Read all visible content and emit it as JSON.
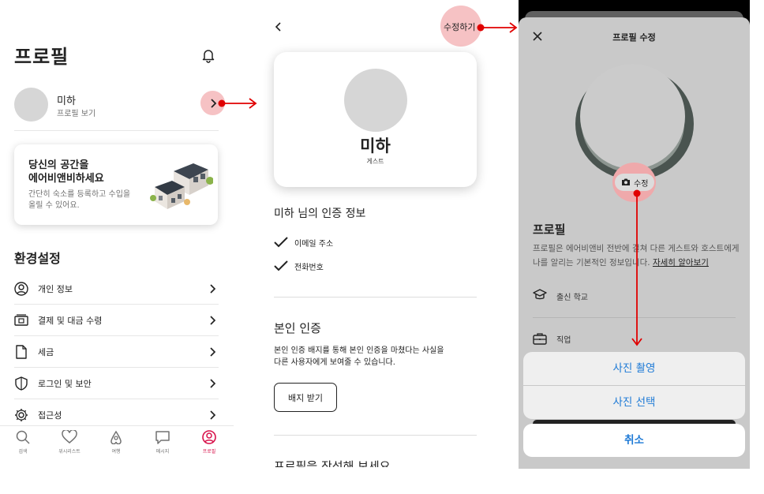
{
  "screen1": {
    "title": "프로필",
    "user": {
      "name": "미하",
      "sub": "프로필 보기"
    },
    "host_card": {
      "title": "당신의 공간을\n에어비앤비하세요",
      "desc": "간단히 숙소를 등록하고 수입을\n올릴 수 있어요."
    },
    "settings_title": "환경설정",
    "menu": [
      {
        "label": "개인 정보",
        "icon": "person-circle-icon"
      },
      {
        "label": "결제 및 대금 수령",
        "icon": "payment-icon"
      },
      {
        "label": "세금",
        "icon": "document-icon"
      },
      {
        "label": "로그인 및 보안",
        "icon": "shield-icon"
      },
      {
        "label": "접근성",
        "icon": "gear-icon"
      }
    ],
    "tabs": [
      {
        "label": "검색",
        "icon": "search-icon"
      },
      {
        "label": "위시리스트",
        "icon": "heart-icon"
      },
      {
        "label": "여행",
        "icon": "airbnb-logo-icon"
      },
      {
        "label": "메시지",
        "icon": "message-icon"
      },
      {
        "label": "프로필",
        "icon": "profile-icon",
        "active": true
      }
    ],
    "accent": "#d8114a"
  },
  "screen2": {
    "edit_label": "수정하기",
    "name": "미하",
    "role": "게스트",
    "verification_title": "미하 님의 인증 정보",
    "verified": [
      "이메일 주소",
      "전화번호"
    ],
    "identity_title": "본인 인증",
    "identity_desc": "본인 인증 배지를 통해 본인 인증을 마쳤다는 사실을\n다른 사용자에게 보여줄 수 있습니다.",
    "badge_button": "배지 받기",
    "next_section": "프로필을 작성해 보세요"
  },
  "screen3": {
    "title": "프로필 수정",
    "edit_chip": "수정",
    "profile_heading": "프로필",
    "profile_desc": "프로필은 에어비앤비 전반에 걸쳐 다른 게스트와 호스트에게 나를 알리는 기본적인 정보입니다. ",
    "learn_more": "자세히 알아보기",
    "fields": [
      "출신 학교",
      "직업"
    ],
    "actions": [
      "사진 촬영",
      "사진 선택"
    ],
    "cancel": "취소",
    "action_color": "#1e7ad6"
  },
  "annotation": {
    "highlight_color": "#f6c2c4",
    "arrow_color": "#e00000"
  }
}
